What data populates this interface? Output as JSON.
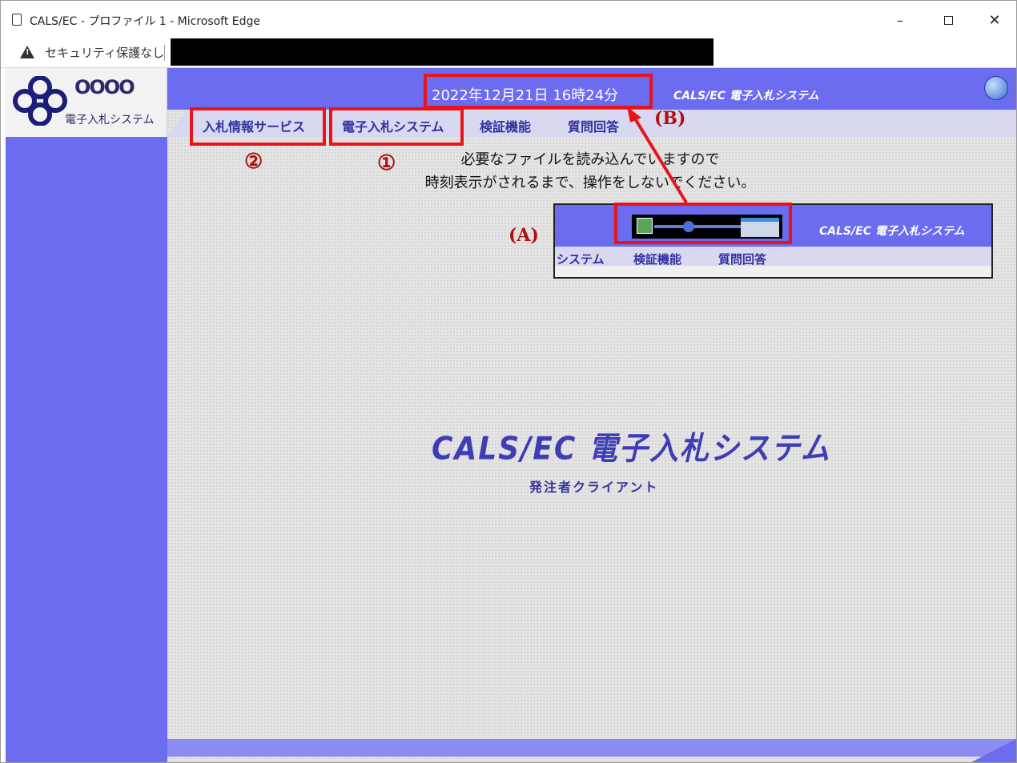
{
  "window": {
    "title": "CALS/EC - プロファイル 1 - Microsoft Edge",
    "controls": {
      "minimize": "–",
      "close": "✕"
    }
  },
  "address_bar": {
    "security_warning": "セキュリティ保護なし"
  },
  "sidebar": {
    "logo_name": "OOOO",
    "logo_subtitle": "電子入札システム"
  },
  "header": {
    "datetime": "2022年12月21日 16時24分",
    "system_title": "CALS/EC 電子入札システム"
  },
  "menu": {
    "items": [
      {
        "label": "入札情報サービス"
      },
      {
        "label": "電子入札システム"
      },
      {
        "label": "検証機能"
      },
      {
        "label": "質問回答"
      }
    ]
  },
  "main": {
    "loading_line1": "必要なファイルを読み込んでいますので",
    "loading_line2": "時刻表示がされるまで、操作をしないでください。",
    "title": "CALS/EC 電子入札システム",
    "subtitle": "発注者クライアント"
  },
  "inset": {
    "system_title": "CALS/EC 電子入札システム",
    "menu": [
      "システム",
      "検証機能",
      "質問回答"
    ]
  },
  "annotations": {
    "label_a": "(A)",
    "label_b": "(B)",
    "marker_1": "①",
    "marker_2": "②",
    "color": "#e8141a"
  },
  "colors": {
    "header_blue": "#6b6cf0",
    "menu_text": "#3232a0"
  }
}
